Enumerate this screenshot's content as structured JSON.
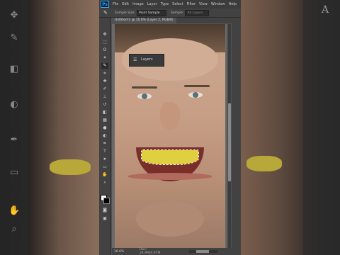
{
  "app": {
    "logo": "Ps",
    "menus": [
      "File",
      "Edit",
      "Image",
      "Layer",
      "Type",
      "Select",
      "Filter",
      "View",
      "Window",
      "Help"
    ]
  },
  "options_bar": {
    "tool_icon": "eyedropper-icon",
    "sample_size_label": "Sample Size:",
    "sample_size_value": "Point Sample",
    "sample_label": "Sample:",
    "sample_value": "All Layers"
  },
  "document": {
    "tab_title": "Untitled-1 @ 16.6% (Layer 2, RGB/8)"
  },
  "layers_panel": {
    "icon": "layers-stack-icon",
    "label": "Layers"
  },
  "status": {
    "zoom": "16.6%",
    "doc_info": "Doc: 24.9M/4.97M"
  },
  "colors": {
    "foreground": "#ffffff",
    "background": "#000000",
    "brand": "#31a8ff",
    "teeth_highlight": "#e0d040"
  }
}
